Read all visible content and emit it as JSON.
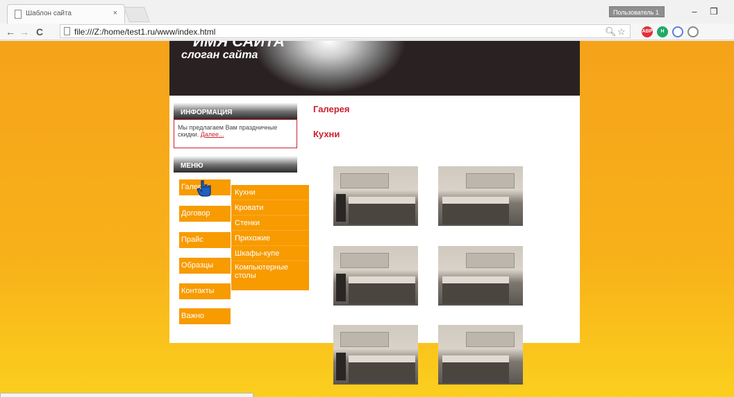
{
  "browser": {
    "tab_title": "Шаблон сайта",
    "tab_close": "×",
    "url": "file:///Z:/home/test1.ru/www/index.html",
    "user_badge": "Пользователь 1",
    "window_minimize": "–",
    "window_restore": "❐",
    "nav_back": "←",
    "nav_forward": "→",
    "nav_reload": "C",
    "extensions": [
      {
        "name": "adblock-icon",
        "label": "ABP",
        "color": "#e0303a"
      },
      {
        "name": "extension-h-icon",
        "label": "H",
        "color": "#20a86a"
      },
      {
        "name": "extension-s-icon",
        "label": "",
        "color": "#5a7fd6"
      },
      {
        "name": "blocked-icon",
        "label": "",
        "color": "#888888"
      }
    ]
  },
  "site": {
    "name": "ИМЯ САЙТА",
    "slogan": "слоган сайта"
  },
  "sidebar": {
    "info_title": "ИНФОРМАЦИЯ",
    "info_text": "Мы предлагаем Вам праздничные скидки.",
    "info_link": "Далее...",
    "menu_title": "МЕНЮ",
    "menu": [
      "Галерея",
      "Договор",
      "Прайс",
      "Образцы",
      "Контакты",
      "Важно"
    ],
    "submenu": [
      "Кухни",
      "Кровати",
      "Стенки",
      "Прихожие",
      "Шкафы-купе",
      "Компьютерные столы"
    ]
  },
  "main": {
    "heading": "Галерея",
    "subheading": "Кухни",
    "thumbnails": [
      "kitchen-photo",
      "kitchen-photo",
      "kitchen-photo",
      "kitchen-photo",
      "kitchen-photo",
      "kitchen-photo"
    ]
  },
  "colors": {
    "accent_red": "#cc1f2f",
    "menu_orange": "#f79b00",
    "page_orange": "#f8b019"
  }
}
